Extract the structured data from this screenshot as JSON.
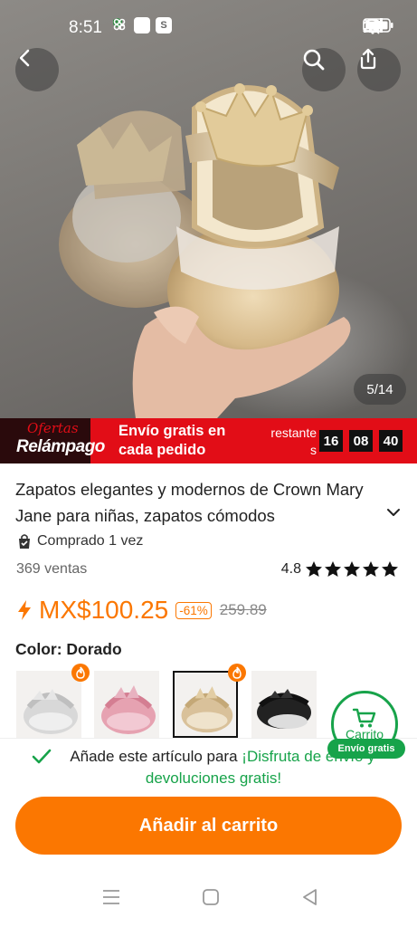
{
  "status_bar": {
    "time": "8:51",
    "notification_icons": [
      "slack-icon",
      "shield-app-icon",
      "s-app-icon",
      "grid-app-icon"
    ],
    "system_icons": [
      "mute-icon",
      "wifi-icon",
      "signal-icon",
      "battery-icon"
    ]
  },
  "hero": {
    "image_counter": "5/14",
    "buttons": [
      "back-arrow-icon",
      "search-icon",
      "share-icon"
    ]
  },
  "flash_banner": {
    "logo_top": "Ofertas",
    "logo_bottom": "Relámpago",
    "promo_line1": "Envío gratis en",
    "promo_line2": "cada pedido",
    "remaining_line1": "restante",
    "remaining_line2": "s",
    "hours": "16",
    "minutes": "08",
    "seconds": "40",
    "colors": {
      "background": "#e20d17",
      "logo_bg": "#2a0a0c"
    }
  },
  "product": {
    "title": "Zapatos elegantes y modernos de Crown Mary Jane para niñas, zapatos cómodos",
    "bought_text": "Comprado 1 vez",
    "sales": "369 ventas",
    "rating": "4.8",
    "stars": 5,
    "price": "MX$100.25",
    "discount": "-61%",
    "old_price": "259.89",
    "color_label": "Color: Dorado",
    "accent_color": "#fb7701"
  },
  "swatches": [
    {
      "name": "silver",
      "hot": false,
      "selected": false
    },
    {
      "name": "pink",
      "hot": true,
      "selected": false
    },
    {
      "name": "gold",
      "hot": true,
      "selected": true
    },
    {
      "name": "black",
      "hot": false,
      "selected": false
    }
  ],
  "cart_float": {
    "label": "Carrito",
    "badge": "Envío gratis",
    "color": "#17a34a"
  },
  "promo": {
    "text_before": "Añade este artículo para ",
    "highlight": "¡Disfruta de envío y devoluciones gratis!"
  },
  "add_to_cart": "Añadir al carrito",
  "nav_bar": [
    "menu-icon",
    "home-square-icon",
    "back-triangle-icon"
  ]
}
